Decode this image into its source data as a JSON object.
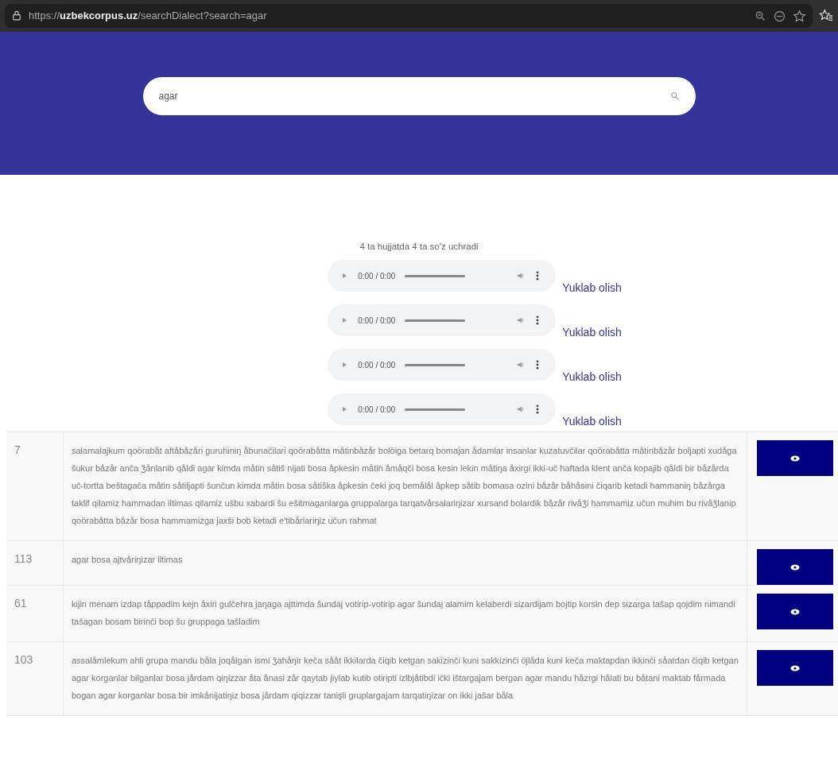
{
  "browser": {
    "url": "https://**uzbekcorpus.uz**/searchDialect?search=agar"
  },
  "search": {
    "value": "agar"
  },
  "result_summary": "4 ta hujjatda 4 ta so'z uchradi",
  "audio_items": [
    {
      "time": "0:00 / 0:00",
      "download_link": "Yuklab olish"
    },
    {
      "time": "0:00 / 0:00",
      "download_link": "Yuklab olish"
    },
    {
      "time": "0:00 / 0:00",
      "download_link": "Yuklab olish"
    },
    {
      "time": "0:00 / 0:00",
      "download_link": "Yuklab olish"
    }
  ],
  "table": {
    "rows": [
      {
        "number": "7",
        "text": "salamalajkum qoörabåt aftåbåzåri guruhiniŋ åbunačilari qoörabåtta måtinbåzår bolöiga betarq bomajan ådamlar insanlar kuzatuvčilar qoörabåtta måtinbåzår boljapti xudåga šukur båzår anča ǯånlanib qåldi agar kimda måtin såtiš nijati bosa åpkesin måtin åmåqči bosa kesin lekin måtiŋa åxirgi ikki-uč haftada klent anča kopajib qåldi bir båzårda uč-tortta beštagača måtin såtiljapti šunčun kimda måtin bosa såtiška åpkesin čeki joq bemålål åpkep såtib bomasa ozini båzår båhåsini čiqarib ketadi hammaniŋ båzårga taklif qilamiz hammadan iltimas qilamiz ušbu xabardi šu ešitmaganlarga gruppalarga tarqatvårsalariŋizar xursand bolardik båzår rivåǯi hammamiz učun muhim bu rivåǯlanip qoörabåtta båzår bosa hammamizga jaxši bob ketadi e'tibårlariŋiz učun rahmat"
      },
      {
        "number": "113",
        "text": "agar bosa ajtvåriŋizar iltimas"
      },
      {
        "number": "61",
        "text": "kijin menam izdap tåppadim kejn åxiri gulčehra jaŋaga ajttimda šundaj votirip-votirip agar šundaj alamim kelaberdi sizardijam bojtip korsin dep sizarga tašap qojdim nimandi tašagan bosam birinči bop šu gruppaga tašladim"
      },
      {
        "number": "103",
        "text": "assalåmlekum ahli grupa mandu båla joqålgan ismi ǯahåŋir keča sååt ikkilarda čiqib ketgan sakizinči kuni sakkizinči öjlåda kuni keča maktapdan ikkinči såatdan čiqib ketgan agar korganlar bilganlar bosa jårdam qiŋizzar åta ånasi zår qaytab jiylab kutib otiripti izlbjåtibdi ički ištargajam bergan agar mandu håzrgi hålati bu båtani maktab fårmada bogan agar korganlar bosa bir imkånijatiŋiz bosa jårdam qiqizzar tanişli gruplargajam tarqatiŋizar on ikki jašar båla"
      }
    ]
  }
}
